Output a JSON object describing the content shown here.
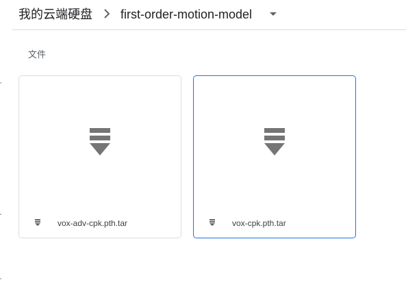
{
  "breadcrumb": {
    "root_label": "我的云端硬盘",
    "separator_icon": "chevron-right-icon",
    "current_label": "first-order-motion-model",
    "dropdown_icon": "caret-down-icon"
  },
  "section": {
    "label": "文件"
  },
  "files": [
    {
      "name": "vox-adv-cpk.pth.tar",
      "icon": "archive-file-icon",
      "selected": false
    },
    {
      "name": "vox-cpk.pth.tar",
      "icon": "archive-file-icon",
      "selected": true
    }
  ],
  "colors": {
    "icon_gray": "#757575",
    "border": "#dadce0",
    "selected_border": "#1a73e8",
    "text": "#202124",
    "secondary_text": "#5f6368"
  }
}
